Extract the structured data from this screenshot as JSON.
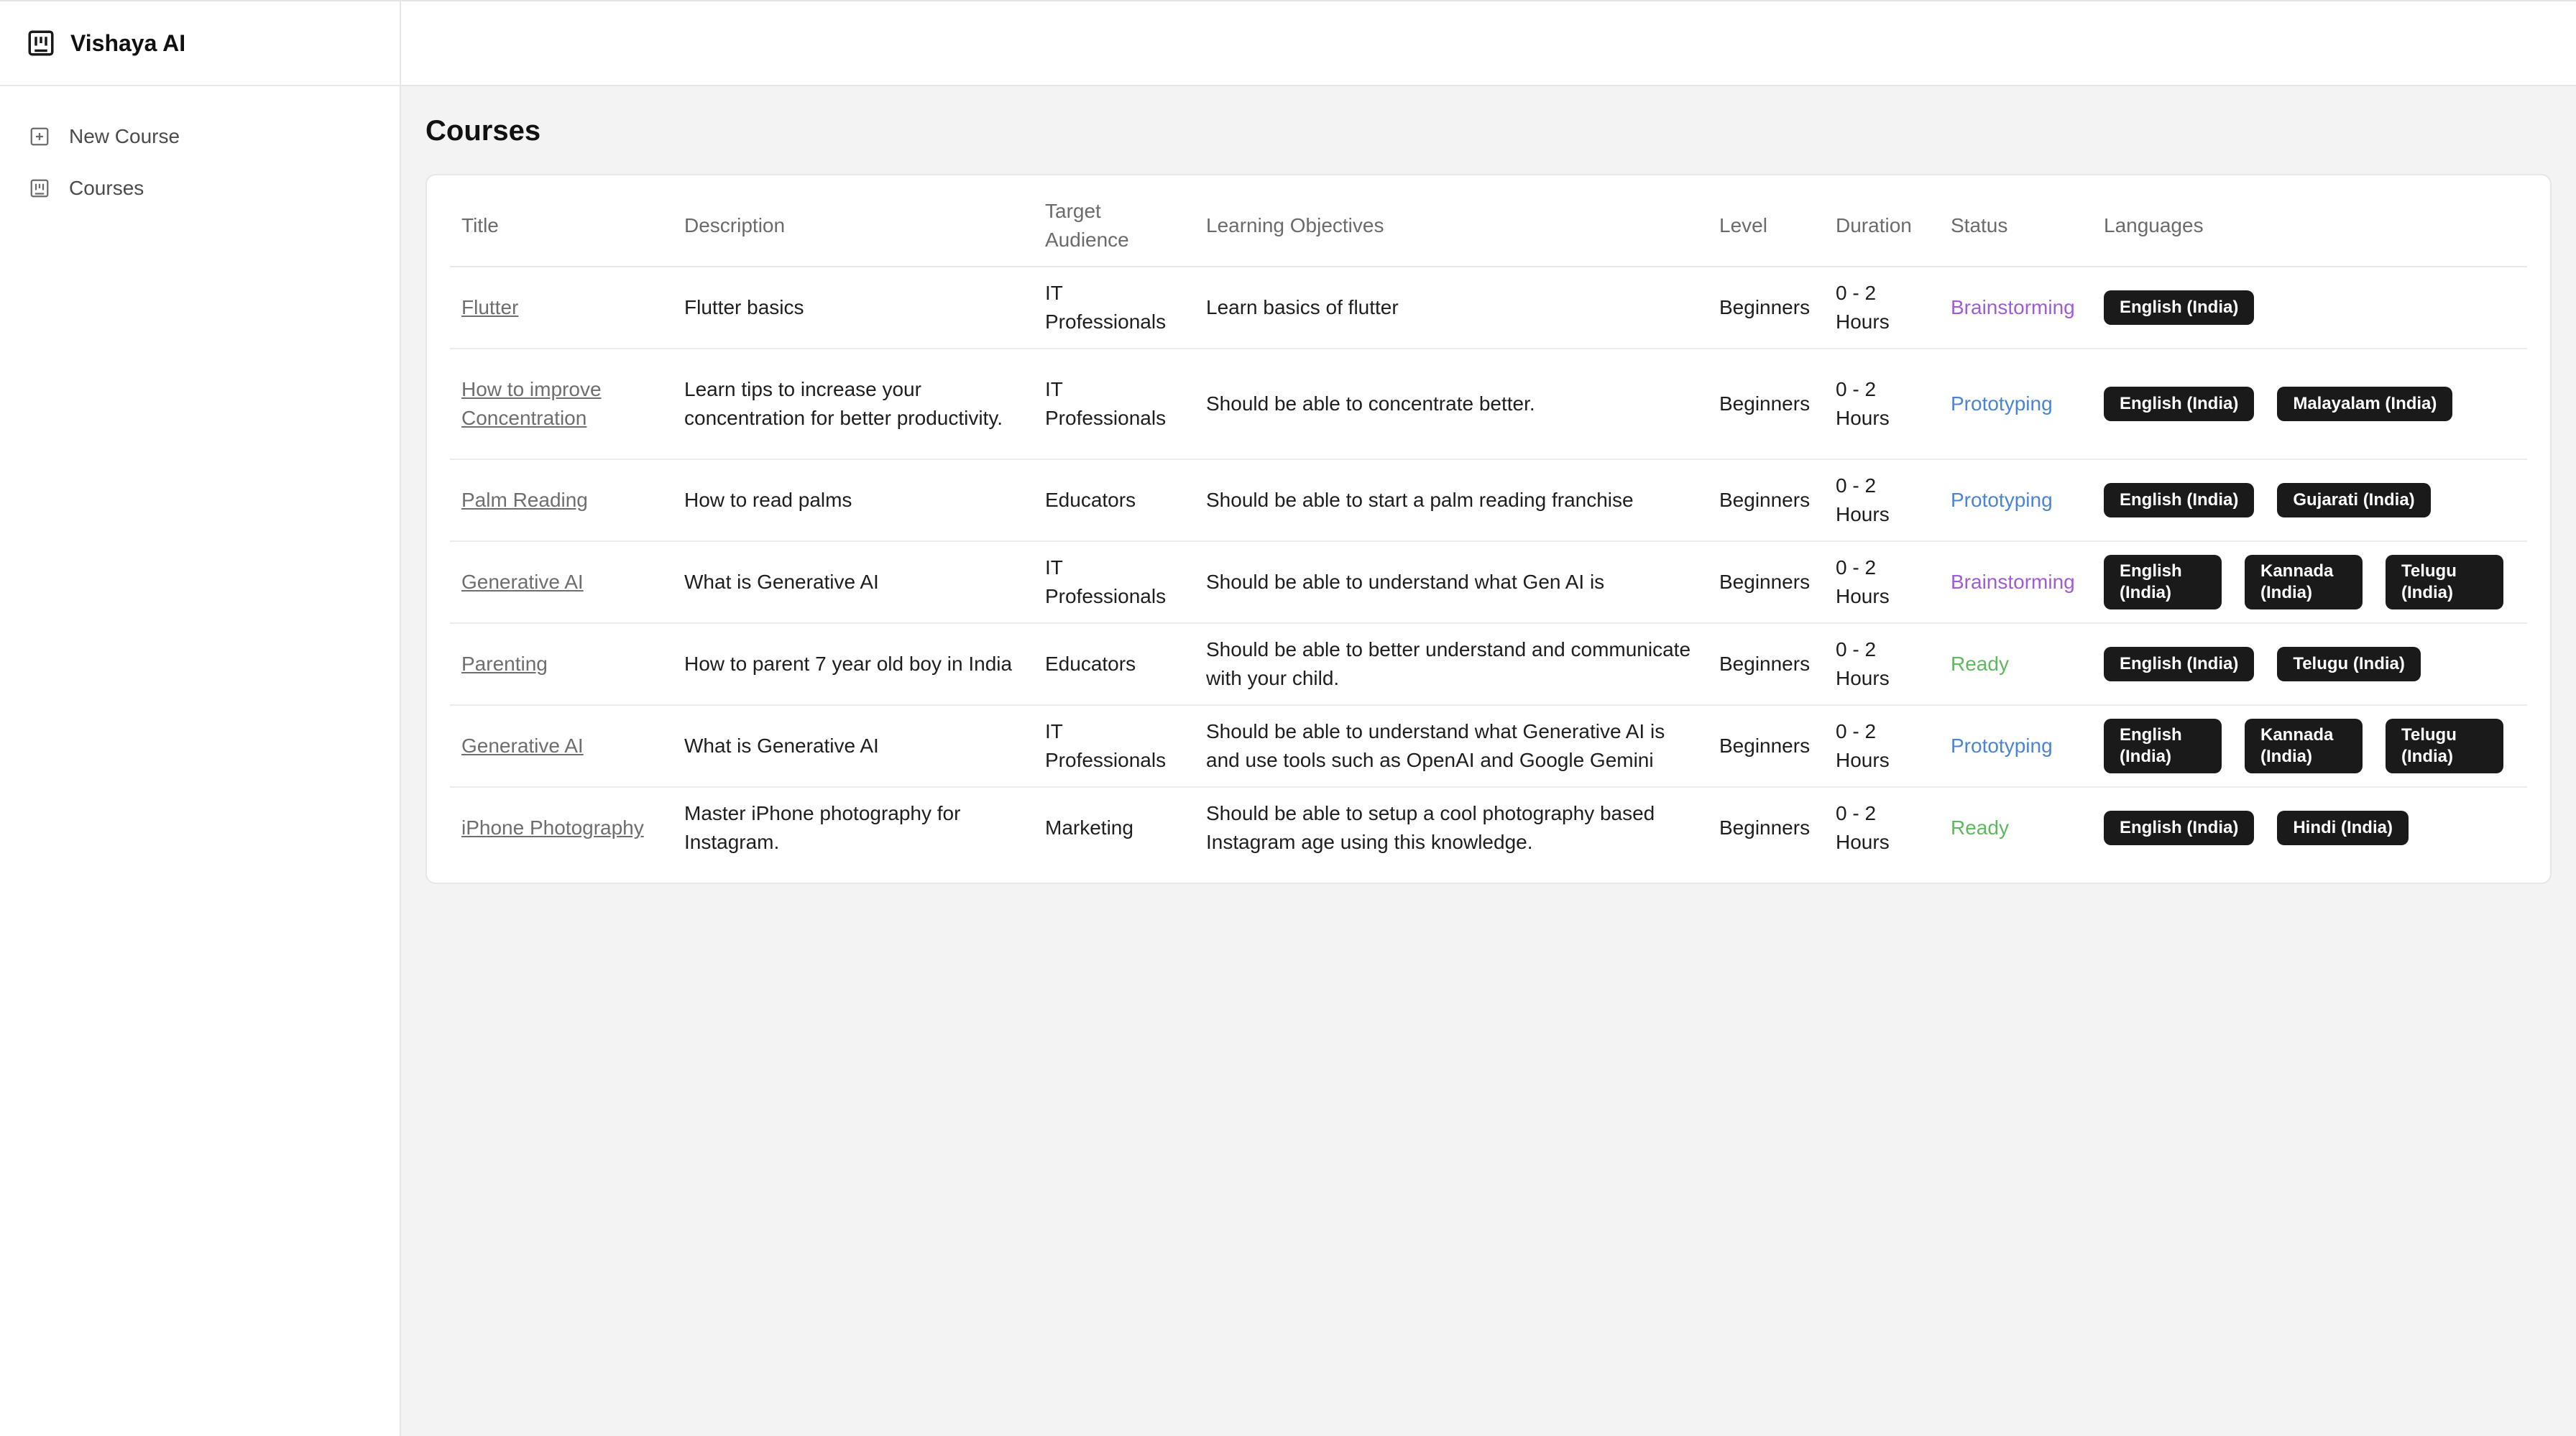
{
  "app": {
    "name": "Vishaya AI"
  },
  "sidebar": {
    "items": [
      {
        "label": "New Course",
        "icon": "plus-square-icon"
      },
      {
        "label": "Courses",
        "icon": "book-list-icon"
      }
    ]
  },
  "page": {
    "title": "Courses"
  },
  "table": {
    "headers": {
      "title": "Title",
      "description": "Description",
      "audience": "Target Audience",
      "objectives": "Learning Objectives",
      "level": "Level",
      "duration": "Duration",
      "status": "Status",
      "languages": "Languages"
    },
    "rows": [
      {
        "title": "Flutter",
        "description": "Flutter basics",
        "audience": "IT Professionals",
        "objectives": "Learn basics of flutter",
        "level": "Beginners",
        "duration": "0 - 2 Hours",
        "status": "Brainstorming",
        "status_color": "#a05bd8",
        "languages": [
          "English (India)"
        ]
      },
      {
        "title": "How to improve Concentration",
        "description": "Learn tips to increase your concentration for better productivity.",
        "audience": "IT Professionals",
        "objectives": "Should be able to concentrate better.",
        "level": "Beginners",
        "duration": "0 - 2 Hours",
        "status": "Prototyping",
        "status_color": "#4a84d4",
        "languages": [
          "English (India)",
          "Malayalam (India)"
        ]
      },
      {
        "title": "Palm Reading",
        "description": "How to read palms",
        "audience": "Educators",
        "objectives": "Should be able to start a palm reading franchise",
        "level": "Beginners",
        "duration": "0 - 2 Hours",
        "status": "Prototyping",
        "status_color": "#4a84d4",
        "languages": [
          "English (India)",
          "Gujarati (India)"
        ]
      },
      {
        "title": "Generative AI",
        "description": "What is Generative AI",
        "audience": "IT Professionals",
        "objectives": "Should be able to understand what Gen AI is",
        "level": "Beginners",
        "duration": "0 - 2 Hours",
        "status": "Brainstorming",
        "status_color": "#a05bd8",
        "languages": [
          "English (India)",
          "Kannada (India)",
          "Telugu (India)"
        ]
      },
      {
        "title": "Parenting",
        "description": "How to parent 7 year old boy in India",
        "audience": "Educators",
        "objectives": "Should be able to better understand and communicate with your child.",
        "level": "Beginners",
        "duration": "0 - 2 Hours",
        "status": "Ready",
        "status_color": "#5fb85f",
        "languages": [
          "English (India)",
          "Telugu (India)"
        ]
      },
      {
        "title": "Generative AI",
        "description": "What is Generative AI",
        "audience": "IT Professionals",
        "objectives": "Should be able to understand what Generative AI is and use tools such as OpenAI and Google Gemini",
        "level": "Beginners",
        "duration": "0 - 2 Hours",
        "status": "Prototyping",
        "status_color": "#4a84d4",
        "languages": [
          "English (India)",
          "Kannada (India)",
          "Telugu (India)"
        ]
      },
      {
        "title": "iPhone Photography",
        "description": "Master iPhone photography for Instagram.",
        "audience": "Marketing",
        "objectives": "Should be able to setup a cool photography based Instagram age using this knowledge.",
        "level": "Beginners",
        "duration": "0 - 2 Hours",
        "status": "Ready",
        "status_color": "#5fb85f",
        "languages": [
          "English (India)",
          "Hindi (India)"
        ]
      }
    ]
  }
}
